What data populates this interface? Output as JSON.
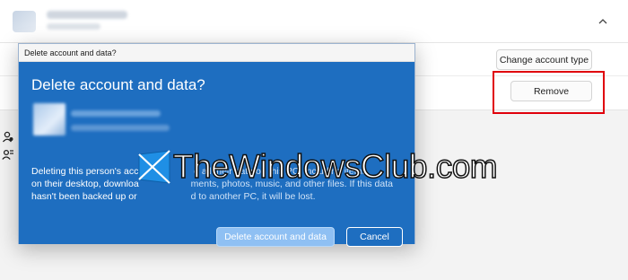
{
  "settings": {
    "change_account_type_label": "Change account type",
    "remove_label": "Remove"
  },
  "dialog": {
    "window_title": "Delete account and data?",
    "heading": "Delete account and data?",
    "warning_lines": [
      "Deleting this person's acco",
      "on their desktop, downloa",
      "hasn't been backed up or"
    ],
    "warning_lines_right": [
      "e all their data on this PC, including items",
      "ments, photos, music, and other files. If this data",
      "d to another PC, it will be lost."
    ],
    "primary_label": "Delete account and data",
    "cancel_label": "Cancel"
  },
  "watermark": {
    "text": "TheWindowsClub.com"
  },
  "colors": {
    "dialog_blue": "#1e6ec0",
    "primary_button": "#8fc0f3",
    "highlight_red": "#e0000b"
  },
  "icons": {
    "collapse": "chevron-up-icon",
    "side_top": "person-settings-icon",
    "side_bottom": "person-switch-icon",
    "logo": "windows-logo-icon"
  }
}
